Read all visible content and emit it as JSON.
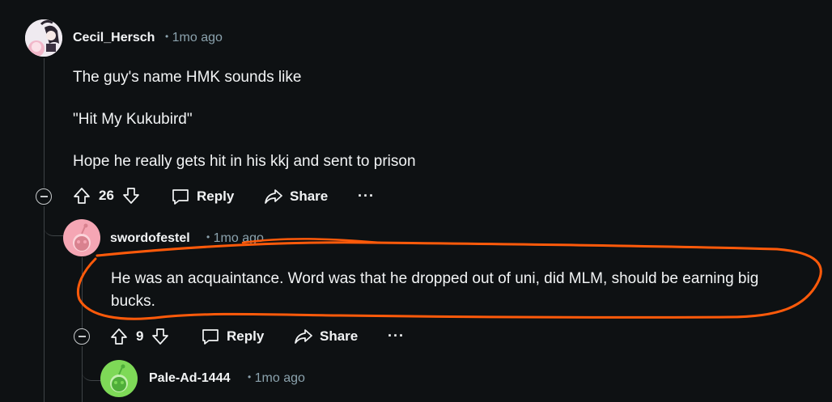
{
  "comments": [
    {
      "username": "Cecil_Hersch",
      "time": "1mo ago",
      "paragraphs": [
        "The guy's name HMK sounds like",
        "\"Hit My Kukubird\"",
        "Hope he really gets hit in his kkj and sent to prison"
      ],
      "votes": "26",
      "reply_label": "Reply",
      "share_label": "Share",
      "more_label": "···"
    },
    {
      "username": "swordofestel",
      "time": "1mo ago",
      "paragraphs": [
        "He was an acquaintance. Word was that he dropped out of uni, did MLM, should be earning big",
        "bucks."
      ],
      "votes": "9",
      "reply_label": "Reply",
      "share_label": "Share",
      "more_label": "···"
    },
    {
      "username": "Pale-Ad-1444",
      "time": "1mo ago"
    }
  ],
  "meta_separator": "•",
  "colors": {
    "background": "#0e1113",
    "text": "#f2f4f5",
    "meta": "#8ba2ad",
    "annotation": "#ff5a0a",
    "avatar2": "#f5a6b4",
    "avatar3": "#7ed957"
  }
}
